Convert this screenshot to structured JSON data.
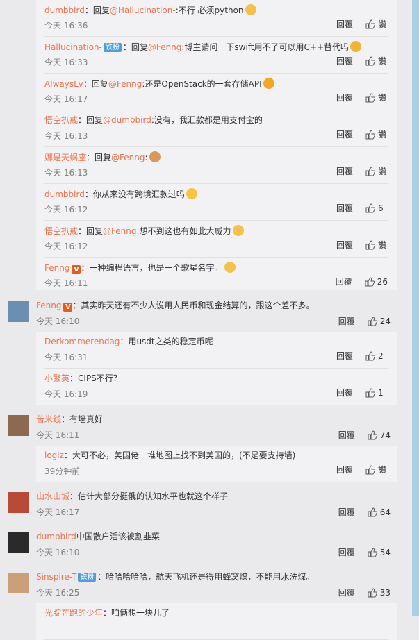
{
  "ui": {
    "reply_label": "回覆",
    "like_label": "讚"
  },
  "nested_top": [
    {
      "name": "dumbbird",
      "prefix": "：回复",
      "mention": "@Hallucination-",
      "text": ":不行 必须python",
      "emoji": "#f2c14e",
      "time": "今天 16:36",
      "likes": "讚"
    },
    {
      "name": "Hallucination-",
      "badge": "铁粉",
      "prefix": "：回复",
      "mention": "@Fenng",
      "text": ":博主请问一下swift用不了可以用C++替代吗",
      "emoji": "#f0b43a",
      "time": "今天 16:33",
      "likes": "讚"
    },
    {
      "name": "AlwaysLv",
      "prefix": "：回复",
      "mention": "@Fenng",
      "text": ":还是OpenStack的一套存储API",
      "emoji": "#f5a623",
      "time": "今天 16:17",
      "likes": "讚"
    },
    {
      "name": "悟空扒戒",
      "prefix": "：回复",
      "mention": "@dumbbird",
      "text": ":没有，我汇款都是用支付宝的",
      "time": "今天 16:13",
      "likes": "讚"
    },
    {
      "name": "娜是天蝎座",
      "prefix": "：回复",
      "mention": "@Fenng",
      "text": ":",
      "emoji": "#d89a5b",
      "time": "今天 16:13",
      "likes": "讚"
    },
    {
      "name": "dumbbird",
      "prefix": "：",
      "mention": "",
      "text": "你从来没有跨境汇款过吗",
      "emoji": "#f5c542",
      "time": "今天 16:12",
      "likes": "6"
    },
    {
      "name": "悟空扒戒",
      "prefix": "：回复",
      "mention": "@Fenng",
      "text": ":想不到这也有如此大威力",
      "emoji": "#f2c14e",
      "time": "今天 16:12",
      "likes": "讚"
    },
    {
      "name": "Fenng",
      "vip": true,
      "prefix": "：",
      "mention": "",
      "text": "一种编程语言，也是一个歌星名字。",
      "emoji": "#f2c14e",
      "time": "今天 16:11",
      "likes": "26"
    }
  ],
  "comments": [
    {
      "id": "c1",
      "name": "Fenng",
      "vip": true,
      "text": "：其实昨天还有不少人说用人民币和现金结算的，跟这个差不多。",
      "time": "今天 16:10",
      "likes": "24",
      "replies": [
        {
          "name": "Derkommerendag",
          "prefix": "：",
          "mention": "",
          "text": "用usdt之类的稳定币呢",
          "time": "今天 16:31",
          "likes": "2"
        },
        {
          "name": "小繁英",
          "prefix": "：",
          "mention": "",
          "text": "CIPS不行？",
          "time": "今天 16:19",
          "likes": "1"
        }
      ]
    },
    {
      "id": "c2",
      "name": "苦米线",
      "text": "：有墙真好",
      "time": "今天 16:11",
      "likes": "74",
      "replies": [
        {
          "name": "logiz",
          "prefix": "：",
          "mention": "",
          "text": "大可不必，美国佬一堆地图上找不到美国的，(不是要支持墙)",
          "time": "39分钟前",
          "likes": "讚"
        }
      ]
    },
    {
      "id": "c3",
      "name": "山水山城",
      "text": "：估计大部分挺俄的认知水平也就这个样子",
      "time": "今天 16:17",
      "likes": "64",
      "replies": []
    },
    {
      "id": "c4",
      "name": "dumbbird",
      "text": "中国散户活该被割韭菜",
      "time": "今天 16:10",
      "likes": "54",
      "replies": []
    },
    {
      "id": "c5",
      "name": "Sinspire-T",
      "badge": "铁粉",
      "text": "：哈哈哈哈哈，航天飞机还是得用蜂窝煤，不能用水洗煤。",
      "time": "今天 16:25",
      "likes": "33",
      "replies": [
        {
          "name": "光腚奔跑的少年",
          "prefix": "：",
          "mention": "",
          "text": "咱俩想一块儿了",
          "time": "",
          "likes": ""
        }
      ]
    }
  ]
}
